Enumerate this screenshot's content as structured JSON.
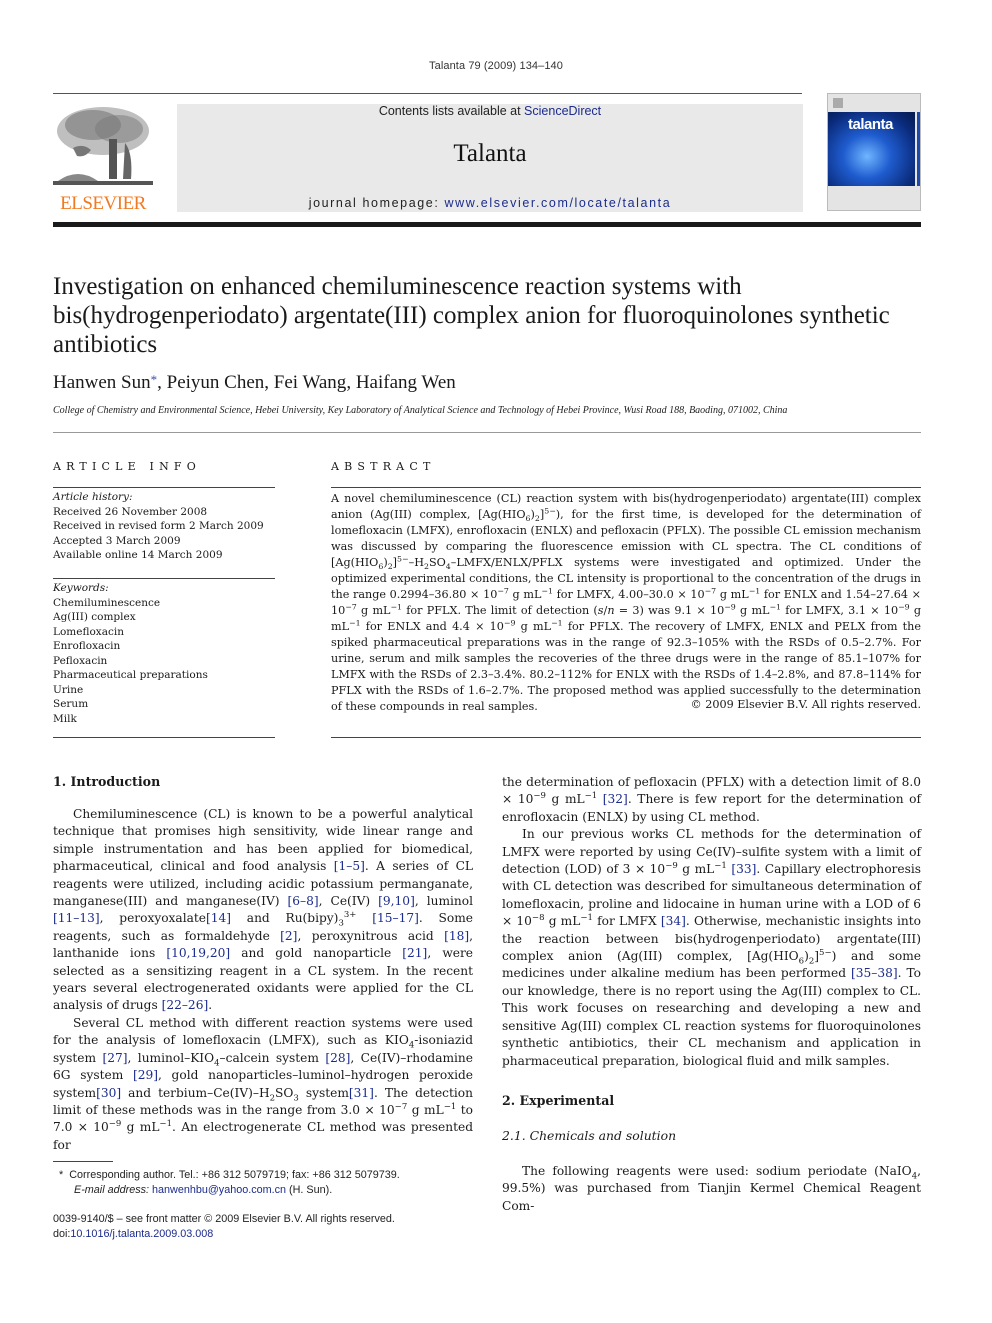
{
  "header": {
    "running_head": "Talanta 79 (2009) 134–140",
    "contents_prefix": "Contents lists available at ",
    "contents_link": "ScienceDirect",
    "journal_name": "Talanta",
    "homepage_prefix": "journal homepage: ",
    "homepage_link": "www.elsevier.com/locate/talanta",
    "publisher_logo_text": "ELSEVIER",
    "cover_title": "talanta",
    "colors": {
      "publisher_orange": "#f07a22",
      "link_blue": "#1c2c8c",
      "banner_gray": "#e9e9e9"
    }
  },
  "article": {
    "title": "Investigation on enhanced chemiluminescence reaction systems with bis(hydrogenperiodato) argentate(III) complex anion for fluoroquinolones synthetic antibiotics",
    "authors": [
      "Hanwen Sun",
      "Peiyun Chen",
      "Fei Wang",
      "Haifang Wen"
    ],
    "author_mark": "*",
    "affiliation": "College of Chemistry and Environmental Science, Hebei University, Key Laboratory of Analytical Science and Technology of Hebei Province, Wusi Road 188, Baoding, 071002, China"
  },
  "article_info": {
    "heading": "ARTICLE INFO",
    "history_label": "Article history:",
    "history": [
      "Received 26 November 2008",
      "Received in revised form 2 March 2009",
      "Accepted 3 March 2009",
      "Available online 14 March 2009"
    ],
    "keywords_label": "Keywords:",
    "keywords": [
      "Chemiluminescence",
      "Ag(III) complex",
      "Lomefloxacin",
      "Enrofloxacin",
      "Pefloxacin",
      "Pharmaceutical preparations",
      "Urine",
      "Serum",
      "Milk"
    ]
  },
  "abstract": {
    "heading": "ABSTRACT",
    "copyright": "© 2009 Elsevier B.V. All rights reserved."
  },
  "sections": {
    "intro_heading": "1.  Introduction",
    "exp_heading": "2.  Experimental",
    "subsec_heading": "2.1.  Chemicals and solution"
  },
  "footnote": {
    "mark": "*",
    "corresponding": "Corresponding author. Tel.: +86 312 5079719; fax: +86 312 5079739.",
    "email_label": "E-mail address:",
    "email": "hanwenhbu@yahoo.com.cn",
    "email_suffix": " (H. Sun).",
    "issn_line": "0039-9140/$ – see front matter © 2009 Elsevier B.V. All rights reserved.",
    "doi_prefix": "doi:",
    "doi": "10.1016/j.talanta.2009.03.008"
  }
}
